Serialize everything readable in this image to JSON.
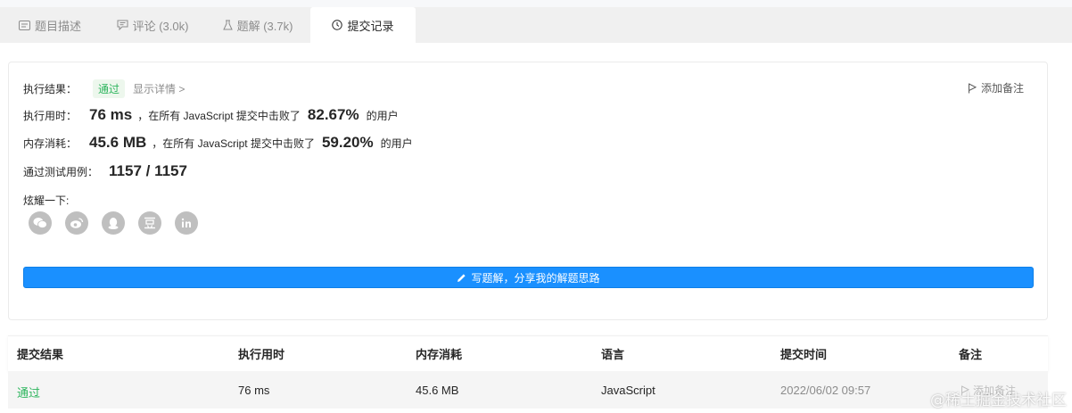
{
  "tabs": [
    {
      "label": "题目描述",
      "icon": "description-icon"
    },
    {
      "label": "评论 (3.0k)",
      "icon": "comment-icon"
    },
    {
      "label": "题解 (3.7k)",
      "icon": "flask-icon"
    },
    {
      "label": "提交记录",
      "icon": "clock-icon",
      "active": true
    }
  ],
  "result": {
    "label": "执行结果：",
    "status": "通过",
    "detail_link": "显示详情 >",
    "add_note": "添加备注"
  },
  "runtime": {
    "label": "执行用时：",
    "value": "76 ms",
    "middle": "，在所有 JavaScript 提交中击败了",
    "percent": "82.67%",
    "suffix": "的用户"
  },
  "memory": {
    "label": "内存消耗：",
    "value": "45.6 MB",
    "middle": "，在所有 JavaScript 提交中击败了",
    "percent": "59.20%",
    "suffix": "的用户"
  },
  "testcases": {
    "label": "通过测试用例：",
    "value": "1157 / 1157"
  },
  "share": {
    "label": "炫耀一下:",
    "icons": [
      "wechat-icon",
      "weibo-icon",
      "qq-icon",
      "douban-icon",
      "linkedin-icon"
    ]
  },
  "write_button": "写题解，分享我的解题思路",
  "table": {
    "headers": [
      "提交结果",
      "执行用时",
      "内存消耗",
      "语言",
      "提交时间",
      "备注"
    ],
    "rows": [
      {
        "result": "通过",
        "runtime": "76 ms",
        "memory": "45.6 MB",
        "language": "JavaScript",
        "time": "2022/06/02 09:57",
        "note": "添加备注"
      }
    ]
  },
  "watermark": "@稀土掘金技术社区",
  "colors": {
    "accent": "#1a90ff",
    "success": "#2db55d"
  }
}
